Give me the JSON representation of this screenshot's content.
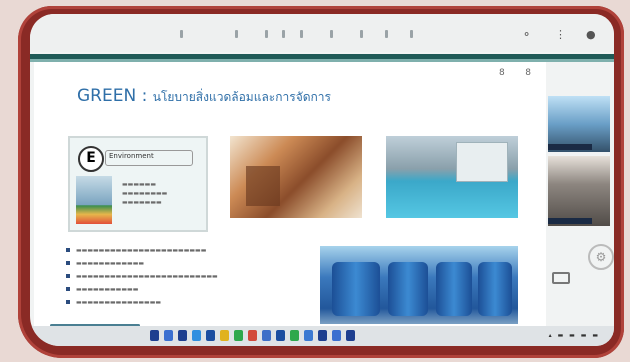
{
  "slide": {
    "page_numbers": "8   8",
    "title": "GREEN :",
    "title_sub": "นโยบายสิ่งแวดล้อมและการจัดการ"
  },
  "env_card": {
    "badge": "E",
    "caption": "Environment"
  },
  "bullets": [
    "",
    "",
    "",
    "",
    ""
  ],
  "taskbar": {
    "icon_colors": [
      "#1e3f8f",
      "#3a6fd0",
      "#1e3f8f",
      "#2f8fe0",
      "#1b4ea0",
      "#e0b21e",
      "#2ea84c",
      "#d24a3b",
      "#3d6fc8",
      "#1b4ea0",
      "#2ea84c",
      "#3b79d2",
      "#1e3f8f",
      "#3a6fd0",
      "#1e3f8f"
    ]
  },
  "toolbar": {
    "right_icons": [
      "bell-icon",
      "info-icon",
      "user-icon"
    ]
  }
}
